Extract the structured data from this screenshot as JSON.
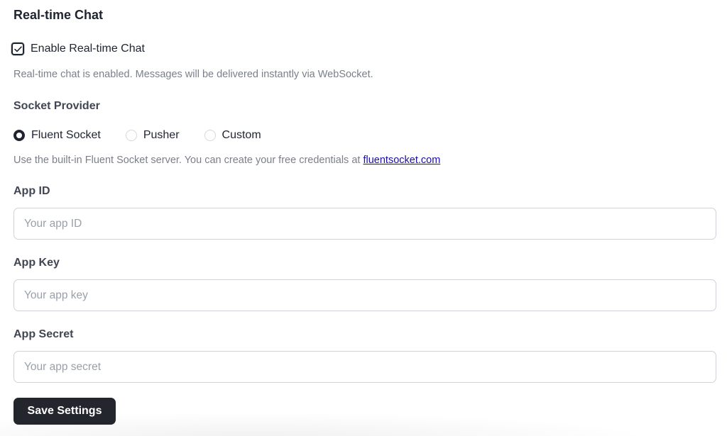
{
  "section": {
    "title": "Real-time Chat"
  },
  "enable_chat": {
    "label": "Enable Real-time Chat",
    "checked": true,
    "help": "Real-time chat is enabled. Messages will be delivered instantly via WebSocket."
  },
  "socket_provider": {
    "label": "Socket Provider",
    "options": [
      {
        "label": "Fluent Socket",
        "selected": true
      },
      {
        "label": "Pusher",
        "selected": false
      },
      {
        "label": "Custom",
        "selected": false
      }
    ],
    "help_text": "Use the built-in Fluent Socket server. You can create your free credentials at",
    "help_link": "fluentsocket.com"
  },
  "fields": {
    "app_id": {
      "label": "App ID",
      "value": "",
      "placeholder": "Your app ID"
    },
    "app_key": {
      "label": "App Key",
      "value": "",
      "placeholder": "Your app key"
    },
    "app_secret": {
      "label": "App Secret",
      "value": "",
      "placeholder": "Your app secret"
    }
  },
  "actions": {
    "save_label": "Save Settings"
  },
  "colors": {
    "primary_dark": "#23262d",
    "link": "#1a0dab",
    "muted_text": "#7a7f89"
  }
}
